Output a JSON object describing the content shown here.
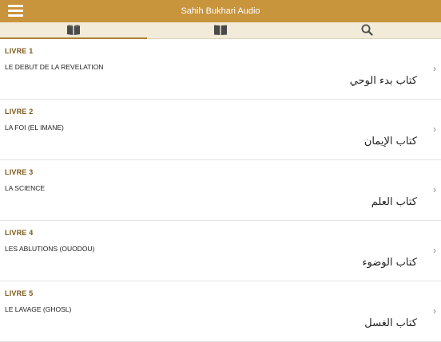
{
  "header": {
    "title": "Sahih Bukhari Audio",
    "background_color": "#c8943c",
    "menu_icon": "hamburger-menu-icon"
  },
  "tabs": [
    {
      "icon": "open-book-icon",
      "active": true
    },
    {
      "icon": "closed-book-icon",
      "active": false
    },
    {
      "icon": "search-icon",
      "active": false
    }
  ],
  "books": [
    {
      "number_label": "LIVRE 1",
      "title_fr": "LE DEBUT DE LA REVELATION",
      "title_ar": "كتاب بدء الوحي"
    },
    {
      "number_label": "LIVRE 2",
      "title_fr": "LA FOI (EL IMANE)",
      "title_ar": "كتاب الإيمان"
    },
    {
      "number_label": "LIVRE 3",
      "title_fr": "LA SCIENCE",
      "title_ar": "كتاب العلم"
    },
    {
      "number_label": "LIVRE 4",
      "title_fr": "LES ABLUTIONS (OUODOU)",
      "title_ar": "كتاب الوضوء"
    },
    {
      "number_label": "LIVRE 5",
      "title_fr": "LE LAVAGE (GHOSL)",
      "title_ar": "كتاب الغسل"
    }
  ],
  "chevron_glyph": "›"
}
